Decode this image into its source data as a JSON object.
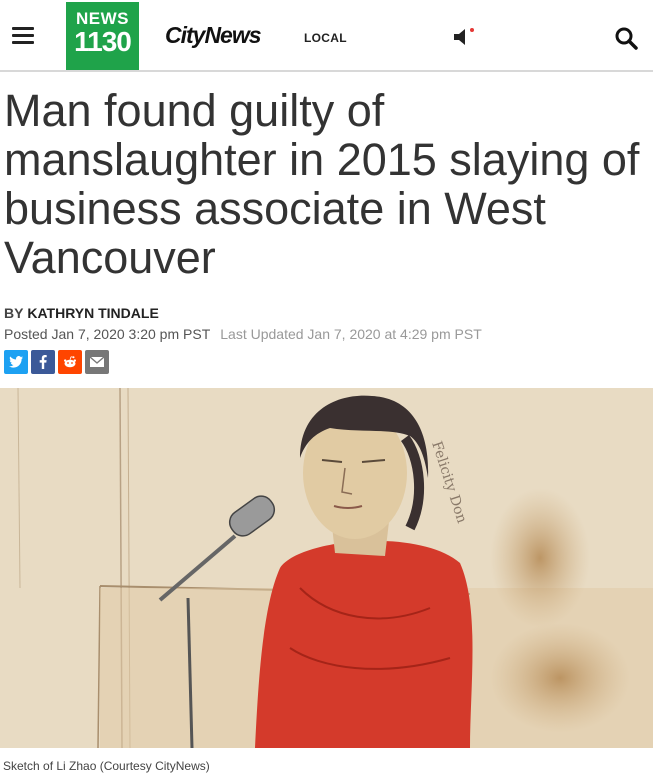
{
  "header": {
    "logo_top": "NEWS",
    "logo_bottom": "1130",
    "brand": "CityNews",
    "nav_local": "LOCAL",
    "logo_color": "#1fa34a"
  },
  "icons": {
    "menu": "hamburger-menu-icon",
    "speaker": "speaker-icon",
    "search": "search-icon"
  },
  "article": {
    "headline": "Man found guilty of manslaughter in 2015 slaying of business associate in West Vancouver",
    "by_label": "BY",
    "author": "KATHRYN TINDALE",
    "posted": "Posted Jan 7, 2020 3:20 pm PST",
    "updated": "Last Updated Jan 7, 2020 at 4:29 pm PST"
  },
  "share": {
    "twitter": "twitter-icon",
    "facebook": "facebook-icon",
    "reddit": "reddit-icon",
    "email": "email-icon"
  },
  "image": {
    "caption": "Sketch of Li Zhao (Courtesy CityNews)",
    "description_icon": "courtroom-sketch"
  }
}
